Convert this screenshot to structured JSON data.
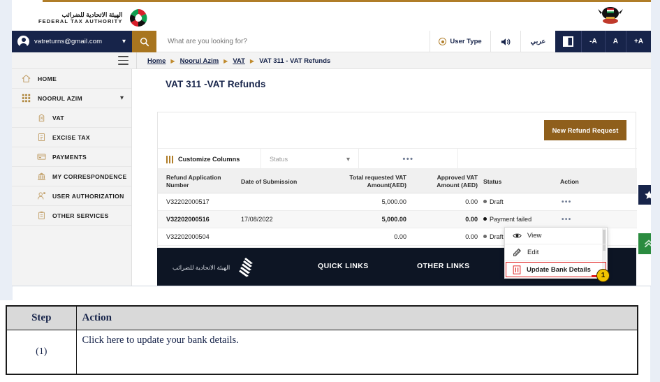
{
  "brand": {
    "arabic_name": "الهيئة الاتحادية للضرائب",
    "english_name": "FEDERAL TAX AUTHORITY",
    "logo_icon": "fta-logo-icon",
    "emblem_icon": "uae-emblem-icon"
  },
  "account": {
    "email": "vatreturns@gmail.com",
    "avatar_icon": "user-avatar-icon",
    "caret_icon": "chevron-down-icon"
  },
  "search": {
    "placeholder": "What are you looking for?",
    "value": "",
    "icon": "search-icon"
  },
  "header_tools": {
    "user_type": "User Type",
    "user_type_icon": "user-type-icon",
    "sound_icon": "speaker-icon",
    "arabic_label": "عربي",
    "contrast_icon": "contrast-icon",
    "font_decrease": "-A",
    "font_normal": "A",
    "font_increase": "+A"
  },
  "breadcrumb": {
    "menu_icon": "hamburger-menu-icon",
    "items": [
      {
        "label": "Home",
        "current": false
      },
      {
        "label": "Noorul Azim",
        "current": false
      },
      {
        "label": "VAT",
        "current": false
      },
      {
        "label": "VAT 311 - VAT Refunds",
        "current": true
      }
    ],
    "separator_icon": "triangle-right-icon"
  },
  "sidebar": {
    "items": [
      {
        "label": "HOME",
        "icon": "home-icon",
        "sub": false,
        "caret": false
      },
      {
        "label": "NOORUL AZIM",
        "icon": "grid-icon",
        "sub": false,
        "caret": true
      },
      {
        "label": "VAT",
        "icon": "vat-icon",
        "sub": true,
        "caret": false
      },
      {
        "label": "EXCISE TAX",
        "icon": "excise-tax-icon",
        "sub": true,
        "caret": false
      },
      {
        "label": "PAYMENTS",
        "icon": "payments-icon",
        "sub": true,
        "caret": false
      },
      {
        "label": "MY CORRESPONDENCE",
        "icon": "correspondence-icon",
        "sub": true,
        "caret": false
      },
      {
        "label": "USER AUTHORIZATION",
        "icon": "user-authorization-icon",
        "sub": true,
        "caret": false
      },
      {
        "label": "OTHER SERVICES",
        "icon": "other-services-icon",
        "sub": true,
        "caret": false
      }
    ]
  },
  "main": {
    "page_title": "VAT 311 -VAT Refunds",
    "new_refund_button": "New Refund Request",
    "toolbar": {
      "customize_columns": "Customize Columns",
      "customize_icon": "columns-icon",
      "status_filter_label": "Status",
      "status_filter_caret": "chevron-down-icon",
      "more_dots": "•••",
      "more_icon": "more-horizontal-icon"
    },
    "table": {
      "columns": [
        "Refund Application Number",
        "Date of Submission",
        "Total requested VAT Amount(AED)",
        "Approved VAT Amount (AED)",
        "Status",
        "Action"
      ],
      "rows": [
        {
          "refund_number": "V32202000517",
          "date_of_submission": "",
          "total_requested": "5,000.00",
          "approved": "0.00",
          "status": "Draft",
          "status_dot": "hollow",
          "action_icon": "more-horizontal-icon",
          "action_dots": "•••"
        },
        {
          "refund_number": "V32202000516",
          "date_of_submission": "17/08/2022",
          "total_requested": "5,000.00",
          "approved": "0.00",
          "status": "Payment failed",
          "status_dot": "filled",
          "action_icon": "more-horizontal-icon",
          "action_dots": "•••"
        },
        {
          "refund_number": "V32202000504",
          "date_of_submission": "",
          "total_requested": "0.00",
          "approved": "0.00",
          "status": "Draft",
          "status_dot": "hollow",
          "action_icon": "more-horizontal-icon",
          "action_dots": "•••"
        }
      ]
    },
    "context_menu": {
      "items": [
        {
          "label": "View",
          "icon": "eye-icon",
          "highlighted": false
        },
        {
          "label": "Edit",
          "icon": "pencil-edit-icon",
          "highlighted": false
        },
        {
          "label": "Update Bank Details",
          "icon": "bank-details-icon",
          "highlighted": true
        }
      ]
    },
    "callout": {
      "number": "1",
      "color": "#f2c400",
      "outline_color": "#e02020"
    }
  },
  "footer": {
    "arabic_name": "الهيئة الاتحادية للضرائب",
    "logo_icon": "fta-falcon-icon",
    "quick_links": "QUICK LINKS",
    "other_links": "OTHER LINKS"
  },
  "rail": {
    "favorite_icon": "star-icon",
    "scroll_top_icon": "chevron-double-up-icon"
  },
  "step_table": {
    "headers": [
      "Step",
      "Action"
    ],
    "rows": [
      {
        "step": "(1)",
        "action": "Click here to update your bank details."
      }
    ]
  },
  "colors": {
    "navy": "#17244a",
    "gold": "#a8751f",
    "brown_button": "#8f5f1c",
    "green": "#2a8b3f",
    "footer_navy": "#0d1524",
    "highlight_red": "#e02020",
    "badge_yellow": "#f2c400"
  }
}
